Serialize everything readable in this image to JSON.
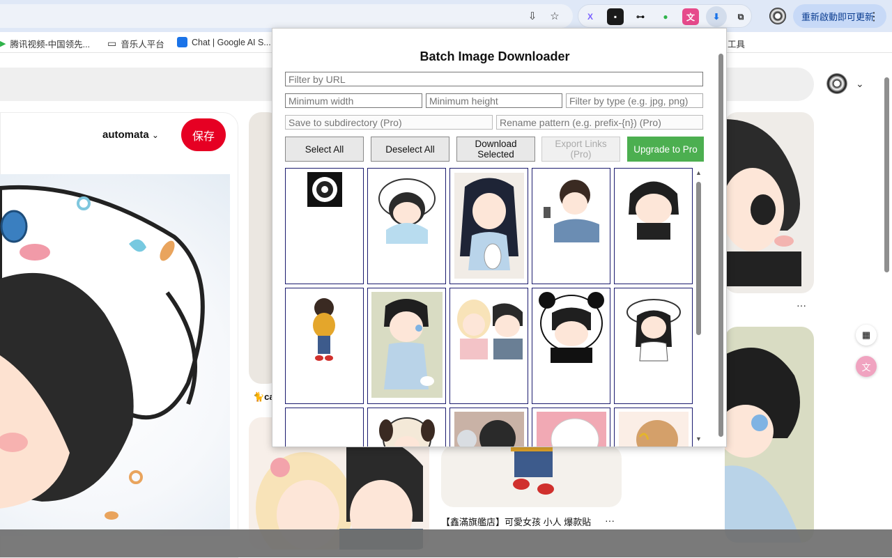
{
  "browser": {
    "restart_label": "重新啟動即可更新",
    "bookmarks": [
      {
        "label": "腾讯视频-中国领先..."
      },
      {
        "label": "音乐人平台"
      },
      {
        "label": "Chat | Google AI S..."
      },
      {
        "label": "工具"
      }
    ]
  },
  "pinterest": {
    "board_name": "automata",
    "save_label": "保存",
    "pin_caption": "【鑫滿旗艦店】可愛女孩 小人 爆款貼",
    "pin_a_caption": "🐈ca",
    "more": "···"
  },
  "popup": {
    "title": "Batch Image Downloader",
    "filter_url_placeholder": "Filter by URL",
    "min_width_placeholder": "Minimum width",
    "min_height_placeholder": "Minimum height",
    "filter_type_placeholder": "Filter by type (e.g. jpg, png)",
    "subdir_placeholder": "Save to subdirectory (Pro)",
    "rename_placeholder": "Rename pattern (e.g. prefix-{n}) (Pro)",
    "buttons": {
      "select_all": "Select All",
      "deselect_all": "Deselect All",
      "download_selected": "Download Selected",
      "export_links": "Export Links (Pro)",
      "upgrade": "Upgrade to Pro"
    }
  },
  "colors": {
    "pinterest_red": "#e60023",
    "upgrade_green": "#4caf50",
    "thumb_border": "#1a1a6e"
  }
}
